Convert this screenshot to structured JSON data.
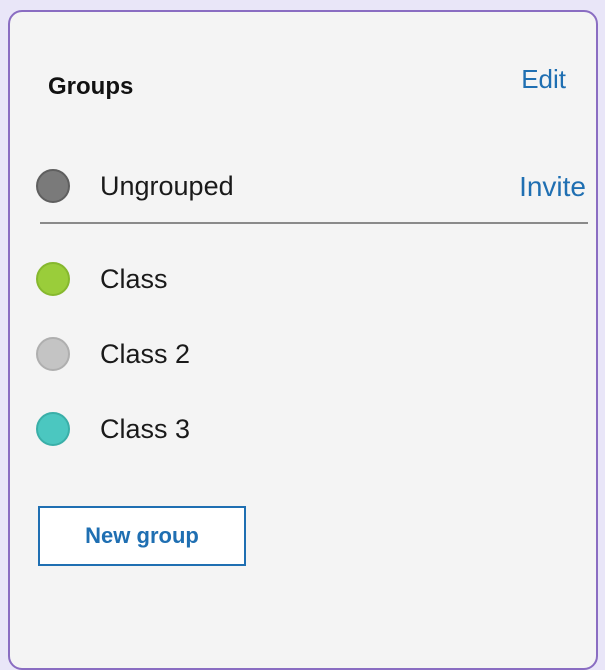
{
  "groups_panel": {
    "title": "Groups",
    "edit_label": "Edit",
    "invite_label": "Invite",
    "new_group_label": "New group",
    "accent_color": "#1F6FB2",
    "border_color": "#8A6DC2",
    "ungrouped": {
      "label": "Ungrouped",
      "color": "#7A7A7A"
    },
    "groups": [
      {
        "label": "Class",
        "color": "#9ACD3A"
      },
      {
        "label": "Class 2",
        "color": "#C4C4C4"
      },
      {
        "label": "Class 3",
        "color": "#4BC7C0"
      }
    ]
  }
}
